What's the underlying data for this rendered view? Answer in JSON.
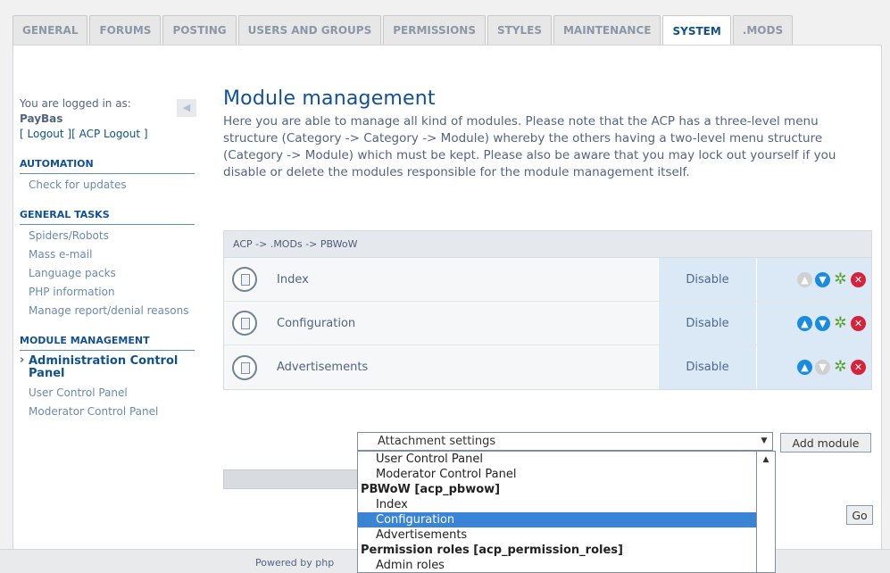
{
  "tabs": [
    "GENERAL",
    "FORUMS",
    "POSTING",
    "USERS AND GROUPS",
    "PERMISSIONS",
    "STYLES",
    "MAINTENANCE",
    "SYSTEM",
    ".MODS"
  ],
  "active_tab": "SYSTEM",
  "login": {
    "prefix": "You are logged in as:",
    "user": "PayBas",
    "logout": "[ Logout ]",
    "acp_logout": "[ ACP Logout ]"
  },
  "sidebar": {
    "sections": [
      {
        "title": "AUTOMATION",
        "items": [
          "Check for updates"
        ]
      },
      {
        "title": "GENERAL TASKS",
        "items": [
          "Spiders/Robots",
          "Mass e-mail",
          "Language packs",
          "PHP information",
          "Manage report/denial reasons"
        ]
      },
      {
        "title": "MODULE MANAGEMENT",
        "items": [
          "Administration Control Panel",
          "User Control Panel",
          "Moderator Control Panel"
        ]
      }
    ],
    "current_item": "Administration Control Panel"
  },
  "main": {
    "title": "Module management",
    "description": "Here you are able to manage all kind of modules. Please note that the ACP has a three-level menu structure (Category -> Category -> Module) whereby the others having a two-level menu structure (Category -> Module) which must be kept. Please also be aware that you may lock out yourself if you disable or delete the modules responsible for the module management itself.",
    "breadcrumb": "ACP -> .MODs -> PBWoW",
    "modules": [
      {
        "name": "Index",
        "action": "Disable"
      },
      {
        "name": "Configuration",
        "action": "Disable"
      },
      {
        "name": "Advertisements",
        "action": "Disable"
      }
    ],
    "module_select": "Attachment settings",
    "add_module": "Add module",
    "go": "Go"
  },
  "dropdown": [
    {
      "label": "User Control Panel",
      "group": false,
      "selected": false
    },
    {
      "label": "Moderator Control Panel",
      "group": false,
      "selected": false
    },
    {
      "label": "PBWoW [acp_pbwow]",
      "group": true,
      "selected": false
    },
    {
      "label": "Index",
      "group": false,
      "selected": false
    },
    {
      "label": "Configuration",
      "group": false,
      "selected": true
    },
    {
      "label": "Advertisements",
      "group": false,
      "selected": false
    },
    {
      "label": "Permission roles [acp_permission_roles]",
      "group": true,
      "selected": false
    },
    {
      "label": "Admin roles",
      "group": false,
      "selected": false
    }
  ],
  "footer": {
    "powered": "Powered by php"
  },
  "colors": {
    "accent": "#115098",
    "selected": "#3a84d8",
    "delete": "#d6223b",
    "move": "#1a8ce0",
    "edit": "#58a32a"
  }
}
